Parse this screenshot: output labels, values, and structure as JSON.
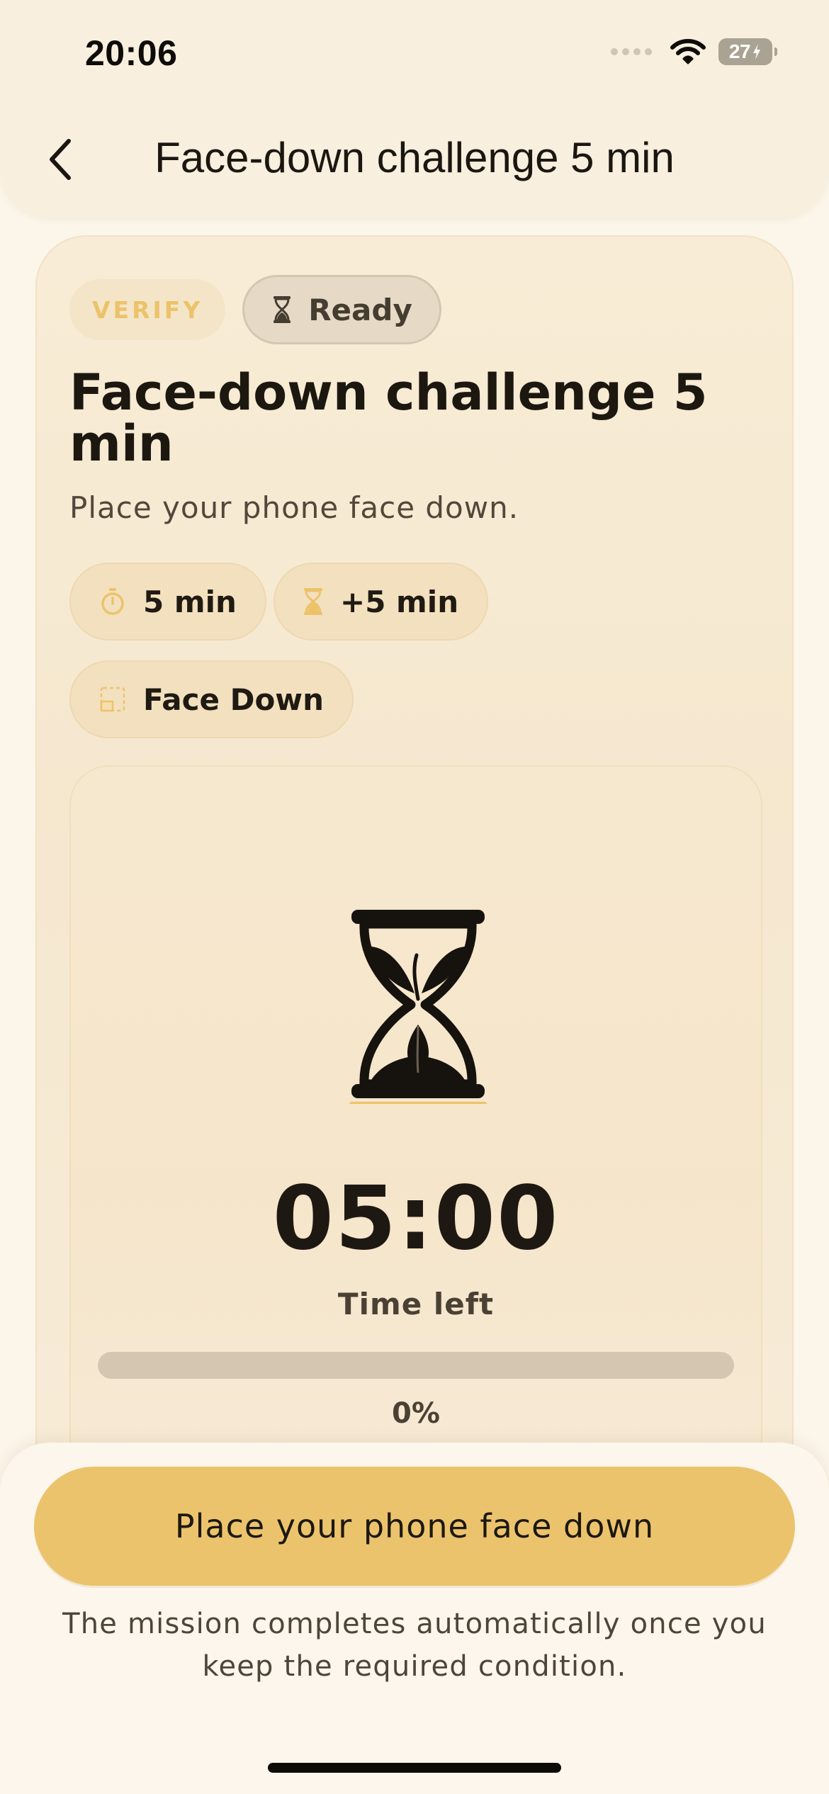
{
  "status_bar": {
    "time": "20:06",
    "battery": "27"
  },
  "header": {
    "title": "Face-down challenge 5 min"
  },
  "mission": {
    "verify_label": "VERIFY",
    "status_label": "Ready",
    "title": "Face-down challenge 5 min",
    "subtitle": "Place your phone face down.",
    "duration": "5 min",
    "bonus": "+5 min",
    "mode": "Face Down"
  },
  "timer": {
    "value": "05:00",
    "caption": "Time left",
    "progress_fraction": 0,
    "progress_text": "0%"
  },
  "footer": {
    "cta_label": "Place your phone face down",
    "hint": "The mission completes automatically once you keep the required condition."
  },
  "colors": {
    "accent": "#ecc36d",
    "background": "#fbf5ea",
    "text": "#1c1810"
  },
  "icons": {
    "back": "chevron-left-icon",
    "status": "hourglass-icon",
    "duration": "timer-icon",
    "bonus": "hourglass-icon",
    "mode": "face-down-icon",
    "art": "hourglass-sprout-icon"
  }
}
